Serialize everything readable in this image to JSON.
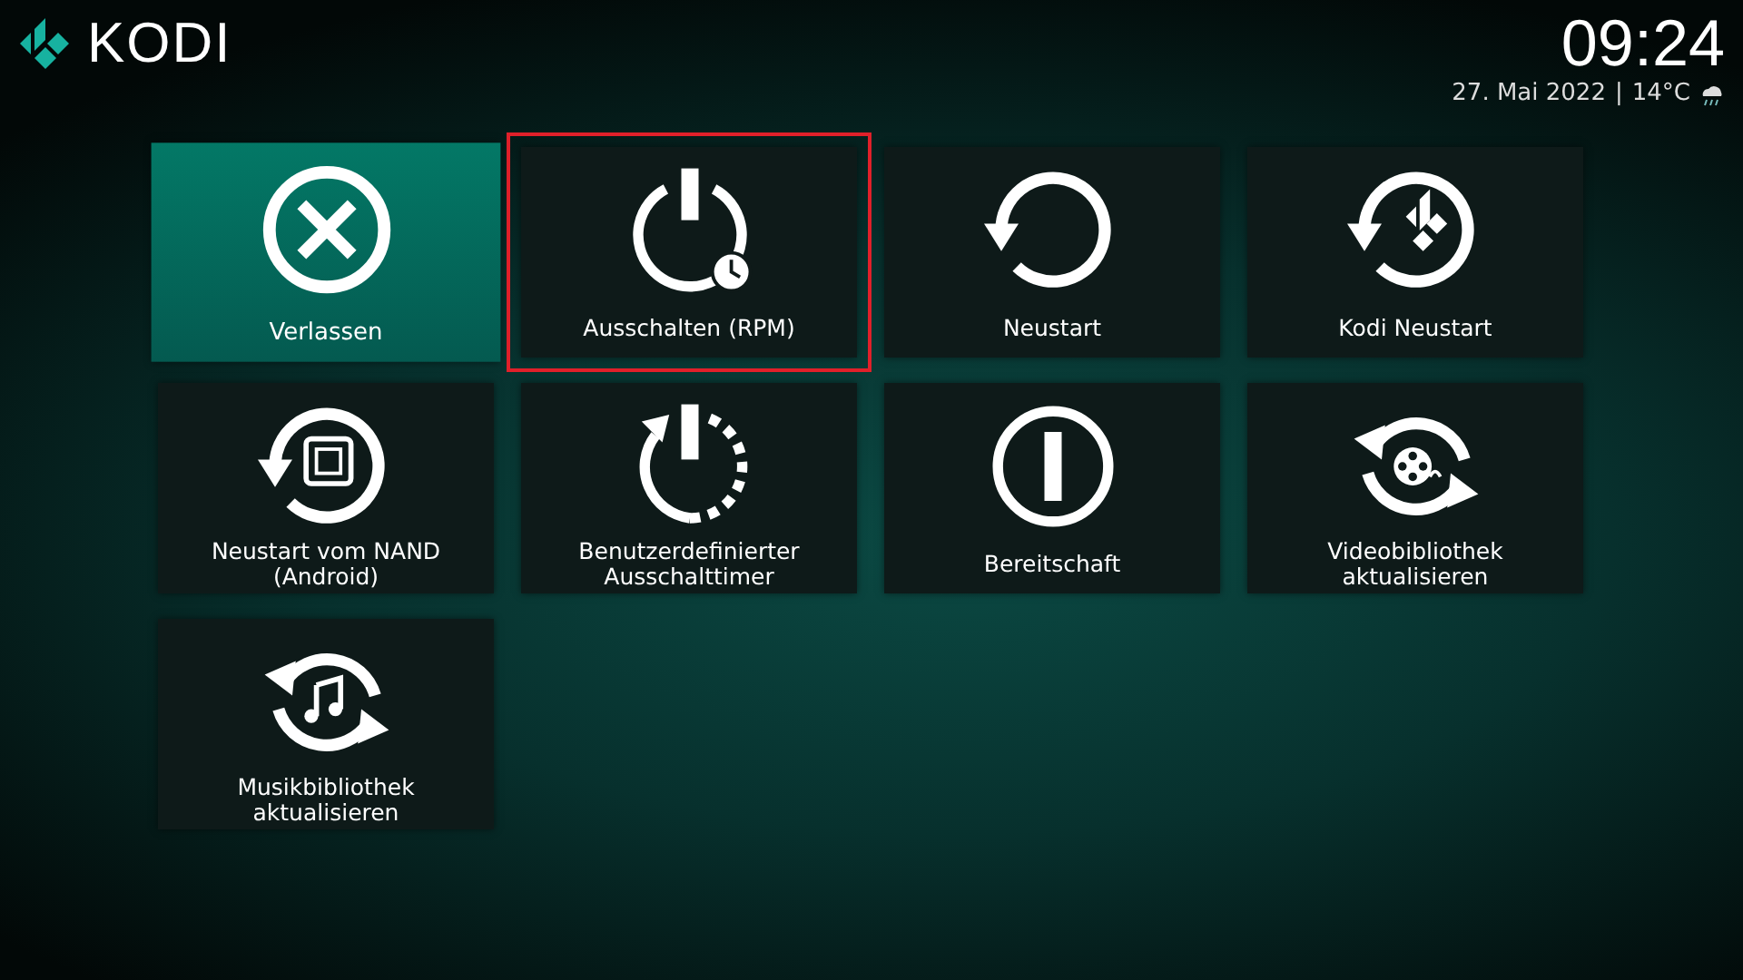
{
  "header": {
    "logo_text": "KODI",
    "time": "09:24",
    "date": "27. Mai 2022",
    "separator": "|",
    "temperature": "14°C"
  },
  "menu": [
    {
      "label": "Verlassen",
      "kind": "exit",
      "selected": true,
      "highlighted": false
    },
    {
      "label": "Ausschalten (RPM)",
      "kind": "power-timer",
      "selected": false,
      "highlighted": true
    },
    {
      "label": "Neustart",
      "kind": "restart",
      "selected": false,
      "highlighted": false
    },
    {
      "label": "Kodi Neustart",
      "kind": "kodi-restart",
      "selected": false,
      "highlighted": false
    },
    {
      "label": "Neustart vom NAND (Android)",
      "kind": "nand-restart",
      "selected": false,
      "highlighted": false
    },
    {
      "label": "Benutzerdefinierter Ausschalttimer",
      "kind": "custom-timer",
      "selected": false,
      "highlighted": false
    },
    {
      "label": "Bereitschaft",
      "kind": "standby",
      "selected": false,
      "highlighted": false
    },
    {
      "label": "Videobibliothek aktualisieren",
      "kind": "video-refresh",
      "selected": false,
      "highlighted": false
    },
    {
      "label": "Musikbibliothek aktualisieren",
      "kind": "music-refresh",
      "selected": false,
      "highlighted": false
    }
  ]
}
